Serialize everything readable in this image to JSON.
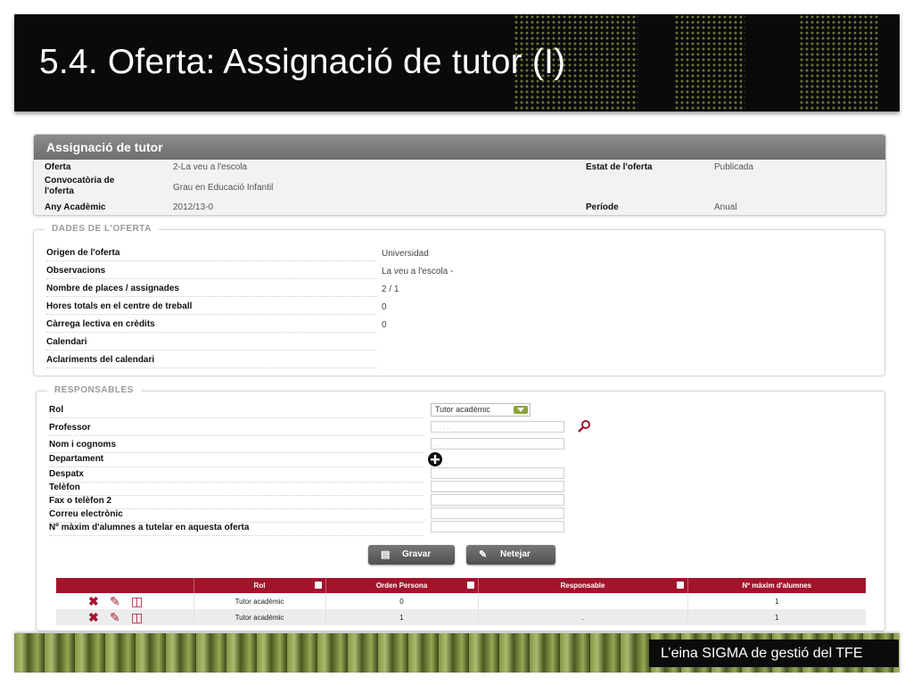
{
  "slide": {
    "title": "5.4. Oferta: Assignació de tutor (I)",
    "footer": "L’eina SIGMA de gestió del TFE"
  },
  "assignacio": {
    "heading": "Assignació de tutor",
    "oferta_label": "Oferta",
    "oferta_value": "2-La veu a l'escola",
    "convocatoria_label": "Convocatòria de l'oferta",
    "convocatoria_value": "Grau en Educació Infantil",
    "any_label": "Any Acadèmic",
    "any_value": "2012/13-0",
    "estat_label": "Estat de l'oferta",
    "estat_value": "Publicada",
    "periode_label": "Període",
    "periode_value": "Anual"
  },
  "dades": {
    "legend": "DADES DE L'OFERTA",
    "rows": [
      {
        "label": "Origen de l'oferta",
        "value": "Universidad"
      },
      {
        "label": "Observacions",
        "value": "La veu a l'escola -"
      },
      {
        "label": "Nombre de places / assignades",
        "value": "2 / 1"
      },
      {
        "label": "Hores totals en el centre de treball",
        "value": "0"
      },
      {
        "label": "Càrrega lectiva en crèdits",
        "value": "0"
      },
      {
        "label": "Calendari",
        "value": ""
      },
      {
        "label": "Aclariments del calendari",
        "value": ""
      }
    ]
  },
  "responsables": {
    "legend": "RESPONSABLES",
    "rol_label": "Rol",
    "rol_selected": "Tutor acadèmic",
    "professor_label": "Professor",
    "professor_placeholder": ". . . .",
    "nom_label": "Nom i cognoms",
    "nom_placeholder": ". .",
    "departament_label": "Departament",
    "despatx_label": "Despatx",
    "telefon_label": "Telèfon",
    "fax_label": "Fax o telèfon 2",
    "correu_label": "Correu electrònic",
    "maxim_label": "Nº màxim d'alumnes a tutelar en aquesta oferta",
    "gravar": "Gravar",
    "netejar": "Netejar"
  },
  "table": {
    "headers": [
      "Rol",
      "Orden Persona",
      "Responsable",
      "Nº màxim d'alumnes"
    ],
    "rows": [
      {
        "rol": "Tutor acadèmic",
        "orden": "0",
        "responsable": "",
        "maxim": "1"
      },
      {
        "rol": "Tutor acadèmic",
        "orden": "1",
        "responsable": ".",
        "maxim": "1"
      }
    ]
  }
}
